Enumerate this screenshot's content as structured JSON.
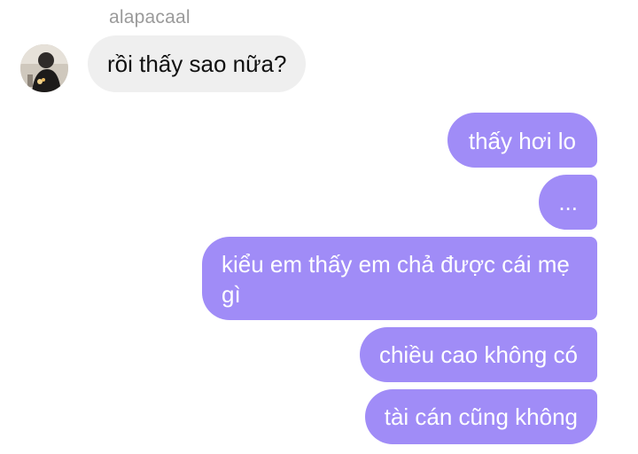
{
  "incoming": {
    "sender_name": "alapacaal",
    "avatar": "user-avatar-photo",
    "message": "rồi thấy sao nữa?"
  },
  "outgoing": [
    "thấy hơi lo",
    "...",
    "kiểu em thấy em chả được cái mẹ gì",
    "chiều cao không có",
    "tài cán cũng không"
  ],
  "colors": {
    "incoming_bubble": "#efefef",
    "outgoing_bubble": "#a08cf7",
    "sender_name": "#9a9a9a"
  }
}
